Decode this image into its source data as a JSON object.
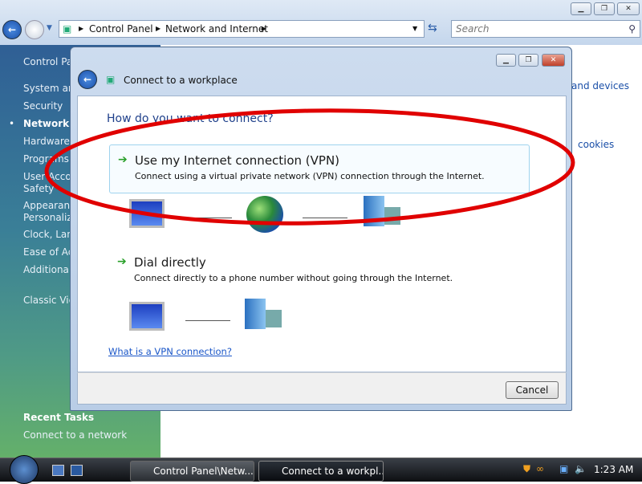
{
  "window": {
    "breadcrumb": [
      "Control Panel",
      "Network and Internet"
    ],
    "search_placeholder": "Search",
    "window_buttons": [
      "minimize",
      "maximize",
      "close"
    ]
  },
  "sidebar": {
    "items": [
      "Control Panel Home",
      "System and Maintenance",
      "Security",
      "Network and Internet",
      "Hardware and Sound",
      "Programs",
      "User Accounts and Family",
      "Safety",
      "Appearance and",
      "Personalization",
      "Clock, Language, and Region",
      "Ease of Access",
      "Additional Options",
      "Classic View"
    ],
    "visible": [
      "Control Pa",
      "System and",
      "Security",
      "Network a",
      "Hardware a",
      "Programs",
      "User Accou",
      "Safety",
      "Appearanc",
      "Personaliza",
      "Clock, Lang",
      "Ease of Acc",
      "Additional",
      "Classic View"
    ],
    "active_index": 3,
    "recent_tasks_label": "Recent Tasks",
    "recent_task": "Connect to a network"
  },
  "right_pane": {
    "fragments": [
      "and devices",
      "cookies"
    ]
  },
  "dialog": {
    "title": "Connect to a workplace",
    "question": "How do you want to connect?",
    "options": [
      {
        "title": "Use my Internet connection (VPN)",
        "desc": "Connect using a virtual private network (VPN) connection through the Internet."
      },
      {
        "title": "Dial directly",
        "desc": "Connect directly to a phone number without going through the Internet."
      }
    ],
    "help_link": "What is a VPN connection?",
    "cancel": "Cancel"
  },
  "annotation": {
    "color": "#e00000",
    "shape": "ellipse"
  },
  "taskbar": {
    "tasks": [
      "Control Panel\\Netw...",
      "Connect to a workpl..."
    ],
    "clock": "1:23 AM"
  }
}
